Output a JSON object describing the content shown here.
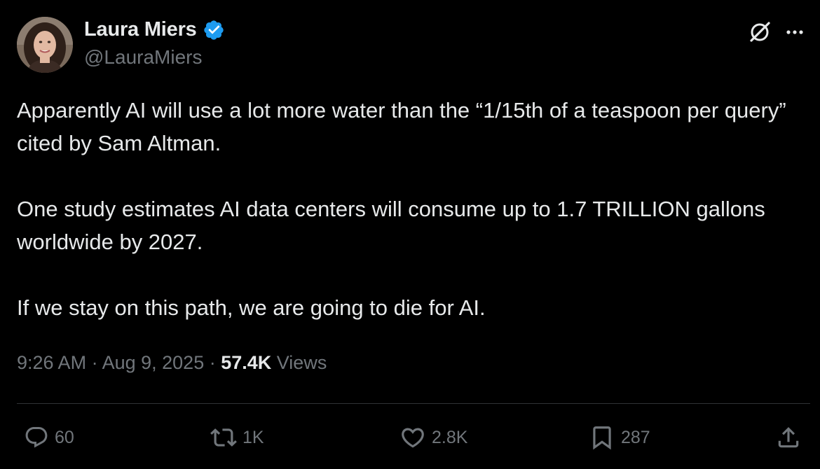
{
  "author": {
    "display_name": "Laura Miers",
    "handle": "@LauraMiers",
    "verified": true,
    "verified_color": "#1d9bf0"
  },
  "header_actions": {
    "grok_icon": "grok-icon",
    "more_icon": "more-horizontal-icon"
  },
  "tweet": {
    "paragraphs": [
      "Apparently AI will use a lot more water than the “1/15th of a teaspoon per query” cited by Sam Altman.",
      "One study estimates AI data centers will consume up to 1.7 TRILLION gallons worldwide by 2027.",
      "If we stay on this path, we are going to die for AI."
    ]
  },
  "meta": {
    "time": "9:26 AM",
    "separator": " · ",
    "date": "Aug 9, 2025",
    "views_count": "57.4K",
    "views_label": " Views"
  },
  "actions": {
    "replies": "60",
    "reposts": "1K",
    "likes": "2.8K",
    "bookmarks": "287"
  },
  "colors": {
    "background": "#000000",
    "text_primary": "#e7e9ea",
    "text_secondary": "#71767b",
    "divider": "#2f3336"
  }
}
